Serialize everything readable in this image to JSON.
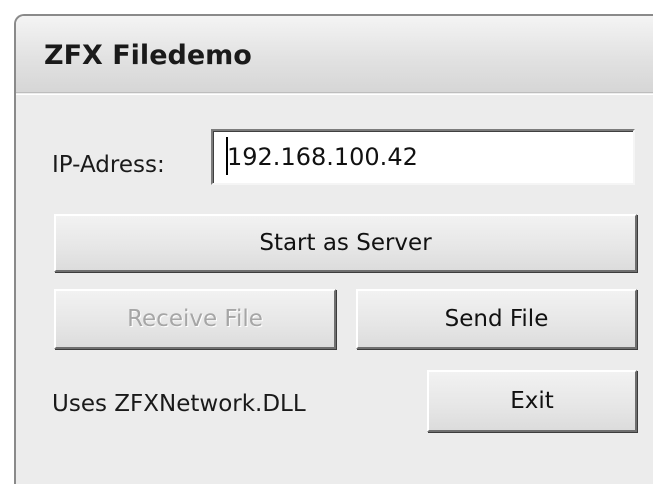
{
  "window": {
    "title": "ZFX Filedemo"
  },
  "form": {
    "ip_label": "IP-Adress:",
    "ip_value": "192.168.100.42",
    "start_server_label": "Start as Server",
    "receive_file_label": "Receive File",
    "receive_file_enabled": false,
    "send_file_label": "Send File",
    "uses_label": "Uses ZFXNetwork.DLL",
    "exit_label": "Exit"
  }
}
